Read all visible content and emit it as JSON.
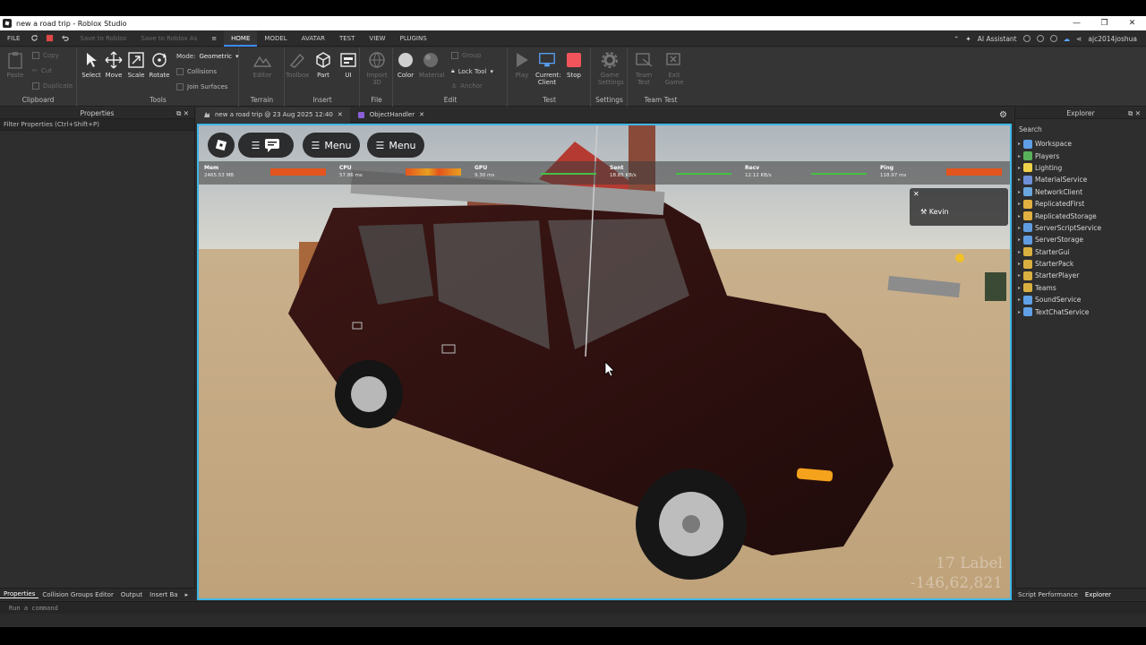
{
  "window": {
    "title": "new a road trip - Roblox Studio",
    "controls": [
      "—",
      "❐",
      "✕"
    ]
  },
  "menubar": {
    "file": "FILE",
    "save_roblox": "Save to Roblox",
    "save_roblox_as": "Save to Roblox As",
    "tabs": [
      "HOME",
      "MODEL",
      "AVATAR",
      "TEST",
      "VIEW",
      "PLUGINS"
    ],
    "ai_assistant": "AI Assistant",
    "username": "ajc2014joshua"
  },
  "ribbon": {
    "clipboard": {
      "label": "Clipboard",
      "paste": "Paste",
      "copy": "Copy",
      "cut": "Cut",
      "duplicate": "Duplicate"
    },
    "tools": {
      "label": "Tools",
      "select": "Select",
      "move": "Move",
      "scale": "Scale",
      "rotate": "Rotate",
      "mode_label": "Mode:",
      "mode_value": "Geometric",
      "collisions": "Collisions",
      "join_surfaces": "Join Surfaces"
    },
    "terrain": {
      "label": "Terrain",
      "editor": "Editor"
    },
    "insert": {
      "label": "Insert",
      "toolbox": "Toolbox",
      "part": "Part",
      "ui": "UI"
    },
    "file": {
      "label": "File",
      "import3d_1": "Import",
      "import3d_2": "3D"
    },
    "edit": {
      "label": "Edit",
      "color": "Color",
      "material": "Material",
      "group": "Group",
      "lock_tool": "Lock Tool",
      "anchor": "Anchor"
    },
    "test": {
      "label": "Test",
      "play": "Play",
      "current_client_1": "Current:",
      "current_client_2": "Client",
      "stop": "Stop"
    },
    "settings": {
      "label": "Settings",
      "game_settings_1": "Game",
      "game_settings_2": "Settings"
    },
    "team_test": {
      "label": "Team Test",
      "team_test_1": "Team",
      "team_test_2": "Test",
      "exit_game_1": "Exit",
      "exit_game_2": "Game"
    }
  },
  "properties": {
    "title": "Properties",
    "filter": "Filter Properties (Ctrl+Shift+P)"
  },
  "bottom_tabs_left": [
    "Properties",
    "Collision Groups Editor",
    "Output",
    "Insert Ba"
  ],
  "doc_tabs": [
    {
      "label": "new a road trip @ 23 Aug 2025 12:40"
    },
    {
      "label": "ObjectHandler"
    }
  ],
  "viewport": {
    "menu_btn_1": "Menu",
    "menu_btn_2": "Menu",
    "stats": [
      {
        "name": "Mem",
        "value": "2465.53 MB",
        "bar_color": "#e3541e"
      },
      {
        "name": "CPU",
        "value": "57.86 ms",
        "bar_color": "#e8a020"
      },
      {
        "name": "GPU",
        "value": "9.30 ms",
        "bar_color": "#44c144"
      },
      {
        "name": "Sent",
        "value": "18.85 KB/s",
        "bar_color": "#44c144"
      },
      {
        "name": "Recv",
        "value": "12.12 KB/s",
        "bar_color": "#44c144"
      },
      {
        "name": "Ping",
        "value": "118.97 ms",
        "bar_color": "#e3541e"
      }
    ],
    "player": "Kevin",
    "corner_label_1": "17 Label",
    "corner_label_2": "-146,62,821"
  },
  "explorer": {
    "title": "Explorer",
    "search_placeholder": "Search",
    "items": [
      {
        "label": "Workspace",
        "icon_color": "#5fa0e6"
      },
      {
        "label": "Players",
        "icon_color": "#58b15a"
      },
      {
        "label": "Lighting",
        "icon_color": "#f0d24a"
      },
      {
        "label": "MaterialService",
        "icon_color": "#6d8fd8"
      },
      {
        "label": "NetworkClient",
        "icon_color": "#6aa7e0"
      },
      {
        "label": "ReplicatedFirst",
        "icon_color": "#e0b040"
      },
      {
        "label": "ReplicatedStorage",
        "icon_color": "#e0b040"
      },
      {
        "label": "ServerScriptService",
        "icon_color": "#5f9de0"
      },
      {
        "label": "ServerStorage",
        "icon_color": "#5f9de0"
      },
      {
        "label": "StarterGui",
        "icon_color": "#d9b040"
      },
      {
        "label": "StarterPack",
        "icon_color": "#d9b040"
      },
      {
        "label": "StarterPlayer",
        "icon_color": "#d9b040"
      },
      {
        "label": "Teams",
        "icon_color": "#d9b040"
      },
      {
        "label": "SoundService",
        "icon_color": "#5fa0e6"
      },
      {
        "label": "TextChatService",
        "icon_color": "#5fa0e6"
      }
    ]
  },
  "bottom_tabs_right": [
    "Script Performance",
    "Explorer"
  ],
  "command_bar": {
    "placeholder": "Run a command"
  },
  "colors": {
    "accent": "#3a8cff",
    "viewport_border": "#3fb6e8",
    "stop": "#f2545b"
  }
}
